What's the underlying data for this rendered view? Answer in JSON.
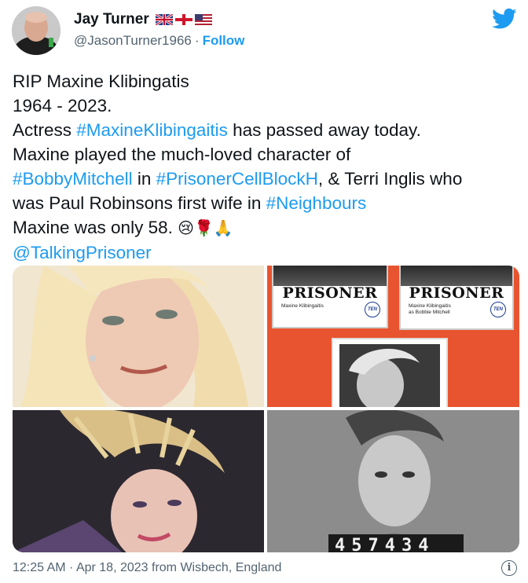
{
  "user": {
    "name": "Jay Turner",
    "handle": "@JasonTurner1966",
    "separator": "·",
    "follow_label": "Follow"
  },
  "tweet": {
    "l1": "RIP Maxine Klibingatis",
    "l2": "1964 - 2023.",
    "l3a": "Actress ",
    "l3b": "#MaxineKlibingaitis",
    "l3c": " has passed away today.",
    "l4": "Maxine played the much-loved character of",
    "l5a": "#BobbyMitchell",
    "l5b": " in ",
    "l5c": "#PrisonerCellBlockH",
    "l5d": ", & Terri Inglis who",
    "l6a": "was Paul Robinsons first wife in ",
    "l6b": "#Neighbours",
    "l7": "Maxine was only 58. ",
    "l7emoji": "😢🌹🙏",
    "l8": "@TalkingPrisoner"
  },
  "media": {
    "card1": {
      "title": "PRISONER",
      "sub": "Maxine Klibingaitis",
      "logo": "TEN"
    },
    "card2": {
      "title": "PRISONER",
      "sub1": "Maxine Klibingaitis",
      "sub2": "as Bobbie Mitchell",
      "logo": "TEN"
    },
    "mugshot_number": "457434"
  },
  "footer": {
    "timestamp": "12:25 AM · Apr 18, 2023 from Wisbech, England",
    "info_glyph": "i"
  },
  "colors": {
    "link": "#1d9bf0",
    "text": "#0f1419",
    "muted": "#536471"
  },
  "icons": [
    "avatar",
    "uk-flag-icon",
    "england-flag-icon",
    "us-flag-icon",
    "twitter-bird-icon",
    "info-icon"
  ]
}
